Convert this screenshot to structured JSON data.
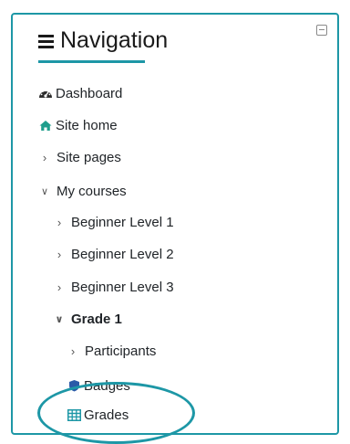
{
  "block": {
    "title": "Navigation"
  },
  "nav": {
    "dashboard": "Dashboard",
    "site_home": "Site home",
    "site_pages": "Site pages",
    "my_courses": "My courses",
    "beginner_1": "Beginner Level 1",
    "beginner_2": "Beginner Level 2",
    "beginner_3": "Beginner Level 3",
    "grade_1": "Grade 1",
    "participants": "Participants",
    "badges": "Badges",
    "grades": "Grades"
  },
  "icons": {
    "dashboard": "tachometer-icon",
    "site_home": "home-icon",
    "badges": "badge-shield-icon",
    "grades": "table-icon",
    "collapse": "collapse-block-icon"
  },
  "colors": {
    "accent": "#1d97a6",
    "site_home_icon": "#1f9e8c",
    "grades_icon": "#1d97a6",
    "badges_icon": "#2a5aa8"
  }
}
